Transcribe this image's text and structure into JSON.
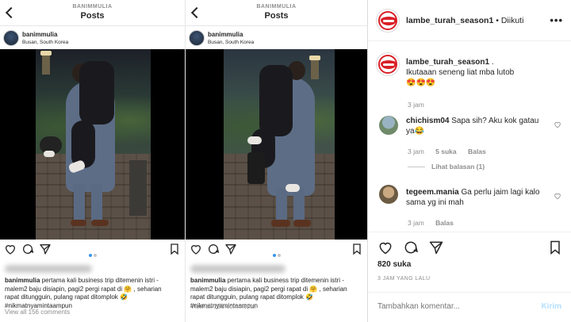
{
  "left_post": {
    "header_user": "BANIMMULIA",
    "header_title": "Posts",
    "username": "banimmulia",
    "location": "Busan, South Korea",
    "caption_user": "banimmulia",
    "caption_lines": [
      "pertama kali business trip ditemenin istri -",
      "malem2 baju disiapin, pagi2 pergi rapat di 🤗 , seharian",
      "rapat ditungguin, pulang rapat ditomplok 🤣",
      "#nikmatnyamintaampun"
    ],
    "view_all": "View all 156 comments"
  },
  "middle_post": {
    "header_user": "BANIMMULIA",
    "header_title": "Posts",
    "username": "banimmulia",
    "location": "Busan, South Korea",
    "caption_user": "banimmulia",
    "caption_lines": [
      "pertama kali business trip ditemenin istri -",
      "malem2 baju disiapin, pagi2 pergi rapat di 🤗 , seharian",
      "rapat ditungguin, pulang rapat ditomplok 🤣",
      "#nikmatnyamintaampun"
    ],
    "view_all": "View all 156 comments"
  },
  "right_post": {
    "account": "lambe_turah_season1",
    "follow_status": "• Diikuti",
    "more": "•••",
    "caption": {
      "user": "lambe_turah_season1",
      "text_line1": ".",
      "text_line2": "Ikutaaan seneng liat mba lutob",
      "emoji": "😍😍😍",
      "time": "3 jam"
    },
    "comments": [
      {
        "user": "chichism04",
        "text": "Sapa sih? Aku kok gatau ya😂",
        "time": "3 jam",
        "likes": "5 suka",
        "reply": "Balas",
        "view_replies": "Lihat balasan (1)"
      },
      {
        "user": "tegeem.mania",
        "text": "Ga perlu jaim lagi kalo sama yg ini mah",
        "time": "3 jam",
        "reply": "Balas"
      }
    ],
    "likes": "820 suka",
    "posted": "3 JAM YANG LALU",
    "add_comment_placeholder": "Tambahkan komentar...",
    "send": "Kirim"
  },
  "colors": {
    "link_blue": "#3897f0",
    "send_disabled": "#b2dffc",
    "brand_red": "#d91f26"
  }
}
